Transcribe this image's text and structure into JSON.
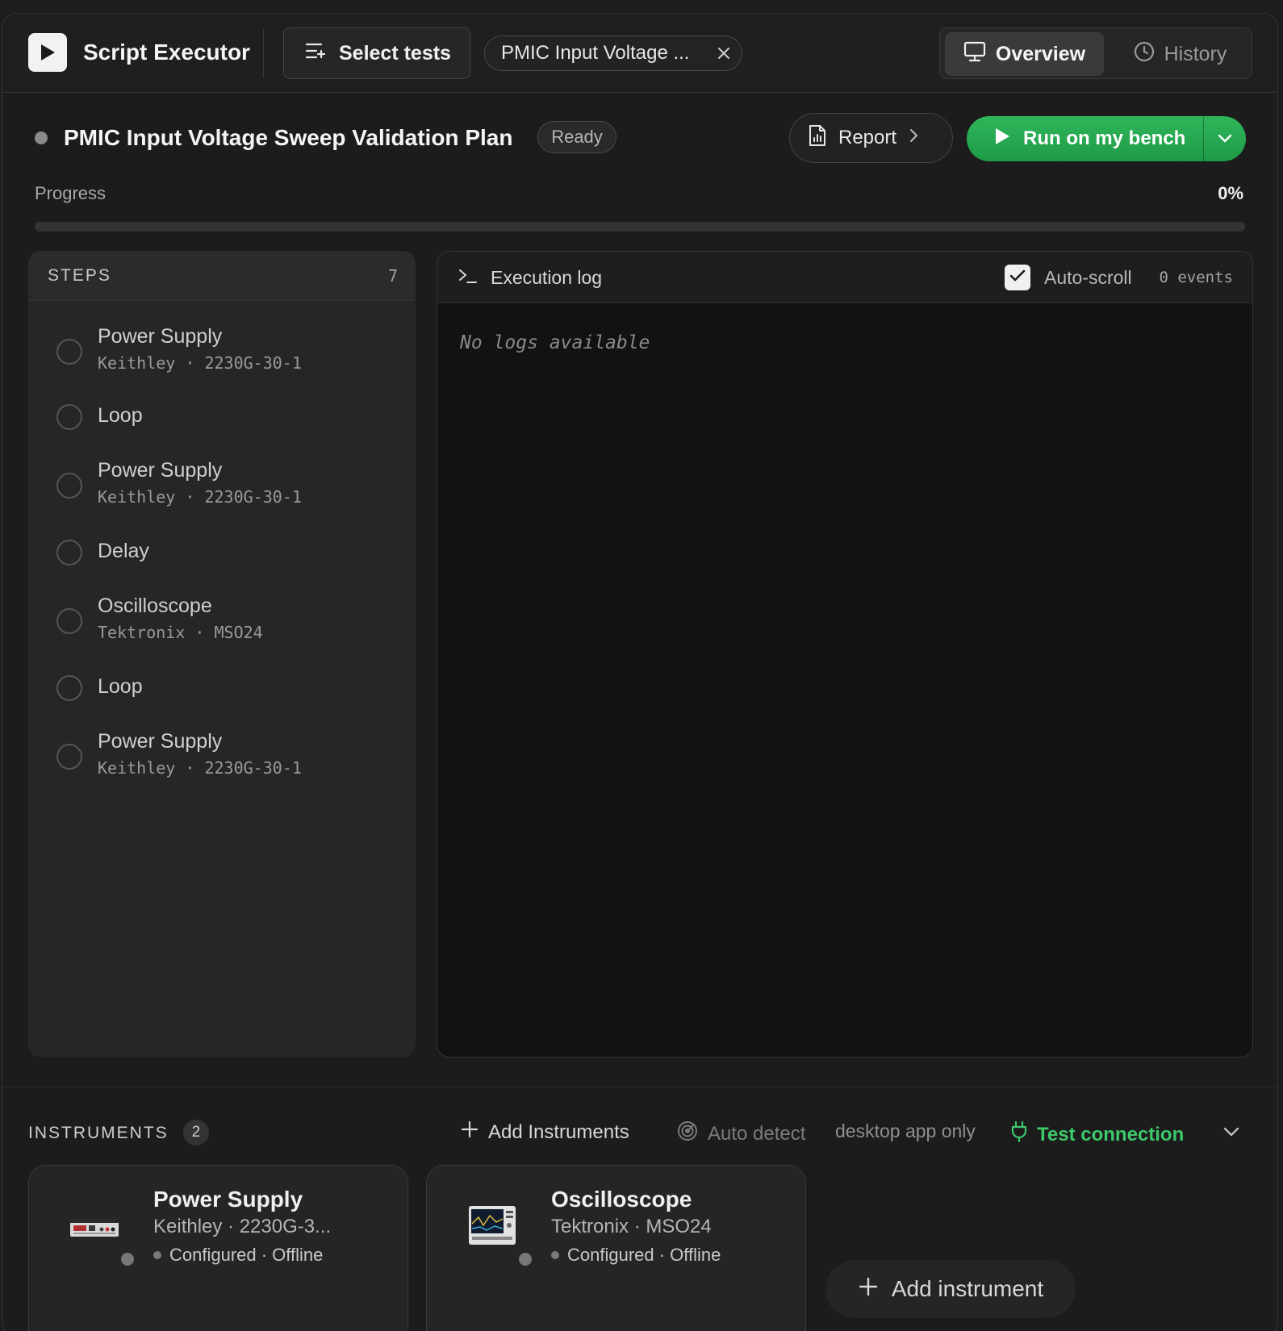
{
  "header": {
    "app_title": "Script Executor",
    "select_tests_label": "Select tests",
    "selected_test_chip": "PMIC Input Voltage ...",
    "tabs": [
      {
        "label": "Overview",
        "active": true,
        "icon": "monitor-icon"
      },
      {
        "label": "History",
        "active": false,
        "icon": "clock-icon"
      }
    ]
  },
  "plan": {
    "title": "PMIC Input Voltage Sweep Validation Plan",
    "status": "Ready",
    "report_label": "Report",
    "run_label": "Run on my bench"
  },
  "progress": {
    "label": "Progress",
    "value_text": "0%",
    "fraction": 0
  },
  "steps": {
    "title": "STEPS",
    "count": "7",
    "items": [
      {
        "name": "Power Supply",
        "sub": "Keithley · 2230G-30-1"
      },
      {
        "name": "Loop",
        "sub": ""
      },
      {
        "name": "Power Supply",
        "sub": "Keithley · 2230G-30-1"
      },
      {
        "name": "Delay",
        "sub": ""
      },
      {
        "name": "Oscilloscope",
        "sub": "Tektronix · MSO24"
      },
      {
        "name": "Loop",
        "sub": ""
      },
      {
        "name": "Power Supply",
        "sub": "Keithley · 2230G-30-1"
      }
    ]
  },
  "log": {
    "title": "Execution log",
    "autoscroll_label": "Auto-scroll",
    "autoscroll_checked": true,
    "events": "0 events",
    "empty_text": "No logs available"
  },
  "instruments": {
    "title": "INSTRUMENTS",
    "count": "2",
    "add_instruments_label": "Add Instruments",
    "auto_detect_label": "Auto detect",
    "desktop_only_label": "desktop app only",
    "test_connection_label": "Test connection",
    "cards": [
      {
        "name": "Power Supply",
        "model": "Keithley · 2230G-3...",
        "status": "Configured · Offline"
      },
      {
        "name": "Oscilloscope",
        "model": "Tektronix · MSO24",
        "status": "Configured · Offline"
      }
    ],
    "add_instrument_label": "Add instrument"
  },
  "colors": {
    "accent_green": "#2fb65a",
    "link_green": "#3dc86a",
    "background": "#1c1c1c"
  }
}
